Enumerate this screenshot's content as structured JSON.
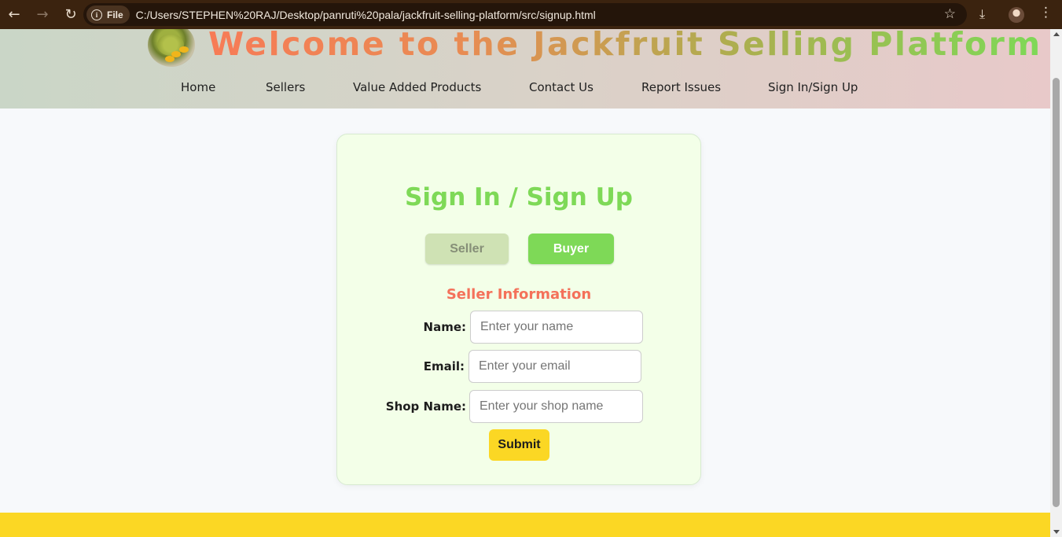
{
  "browser": {
    "back_icon": "back-arrow-icon",
    "forward_icon": "forward-arrow-icon",
    "reload_icon": "reload-icon",
    "file_chip": "File",
    "url": "C:/Users/STEPHEN%20RAJ/Desktop/panruti%20pala/jackfruit-selling-platform/src/signup.html",
    "icons": [
      "info-icon",
      "bookmark-star-icon",
      "download-icon",
      "profile-avatar-icon",
      "menu-dots-icon"
    ]
  },
  "header": {
    "title": "Welcome to the Jackfruit Selling Platform",
    "logo": "jackfruit-logo-icon",
    "nav": [
      "Home",
      "Sellers",
      "Value Added Products",
      "Contact Us",
      "Report Issues",
      "Sign In/Sign Up"
    ]
  },
  "signup": {
    "heading": "Sign In / Sign Up",
    "seller_label": "Seller",
    "buyer_label": "Buyer",
    "section_title": "Seller Information",
    "fields": {
      "name": {
        "label": "Name:",
        "placeholder": "Enter your name",
        "value": ""
      },
      "email": {
        "label": "Email:",
        "placeholder": "Enter your email",
        "value": ""
      },
      "shop": {
        "label": "Shop Name:",
        "placeholder": "Enter your shop name",
        "value": ""
      }
    },
    "submit_label": "Submit"
  },
  "colors": {
    "accent_green": "#7ed957",
    "accent_coral": "#f4715a",
    "accent_yellow": "#fbd724",
    "chrome_brown": "#3b230f"
  }
}
